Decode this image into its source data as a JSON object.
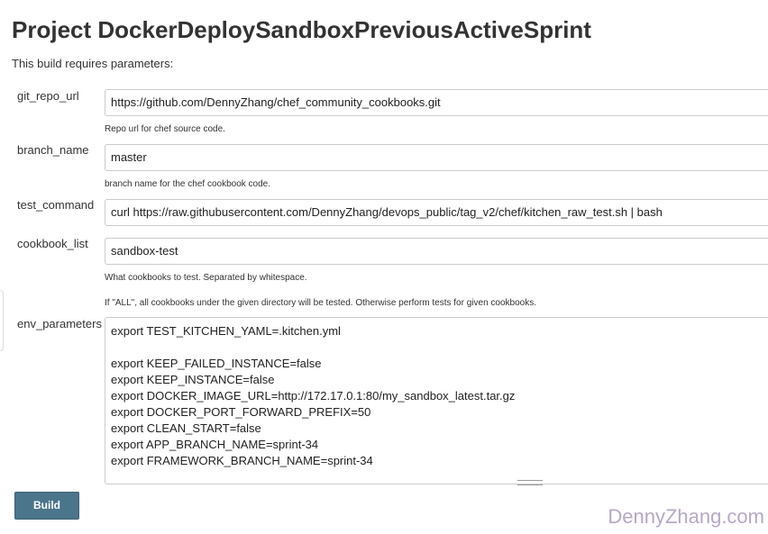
{
  "page": {
    "title": "Project DockerDeploySandboxPreviousActiveSprint",
    "intro": "This build requires parameters:"
  },
  "parameters": [
    {
      "name": "git_repo_url",
      "value": "https://github.com/DennyZhang/chef_community_cookbooks.git",
      "help": [
        "Repo url for chef source code."
      ]
    },
    {
      "name": "branch_name",
      "value": "master",
      "help": [
        "branch name for the chef cookbook code."
      ]
    },
    {
      "name": "test_command",
      "value": "curl https://raw.githubusercontent.com/DennyZhang/devops_public/tag_v2/chef/kitchen_raw_test.sh | bash",
      "help": []
    },
    {
      "name": "cookbook_list",
      "value": "sandbox-test",
      "help": [
        "What cookbooks to test. Separated by whitespace.",
        "If \"ALL\", all cookbooks under the given directory will be tested. Otherwise perform tests for given cookbooks."
      ]
    },
    {
      "name": "env_parameters",
      "lines": [
        "export TEST_KITCHEN_YAML=.kitchen.yml",
        "",
        "export KEEP_FAILED_INSTANCE=false",
        "export KEEP_INSTANCE=false",
        "export DOCKER_IMAGE_URL=http://172.17.0.1:80/my_sandbox_latest.tar.gz",
        "export DOCKER_PORT_FORWARD_PREFIX=50",
        "export CLEAN_START=false",
        "export APP_BRANCH_NAME=sprint-34",
        "export FRAMEWORK_BRANCH_NAME=sprint-34"
      ]
    }
  ],
  "build_button": {
    "label": "Build"
  },
  "watermark": "DennyZhang.com",
  "colors": {
    "button": "#4b758b",
    "watermark": "#b6a8c6"
  }
}
